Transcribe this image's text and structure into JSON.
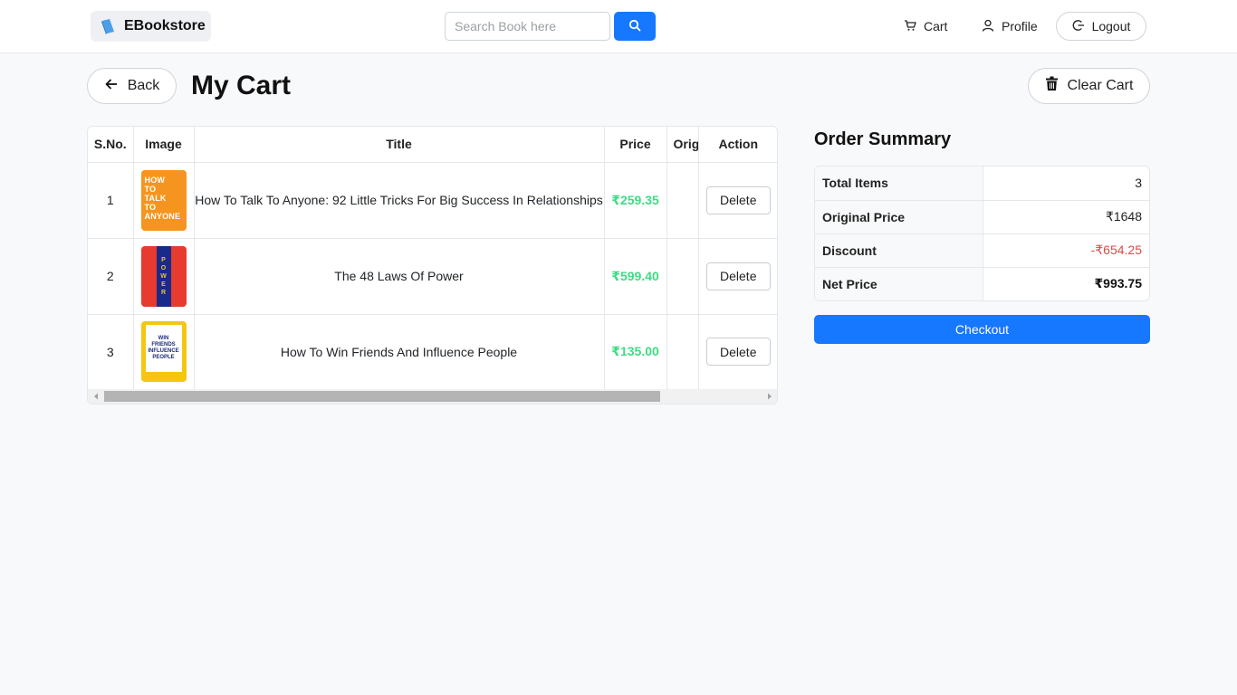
{
  "navbar": {
    "brand": "EBookstore",
    "brand_icon": "book-icon",
    "search_placeholder": "Search Book here",
    "search_icon": "search-icon",
    "cart_label": "Cart",
    "profile_label": "Profile",
    "logout_label": "Logout"
  },
  "header": {
    "back_label": "Back",
    "title": "My Cart",
    "clear_label": "Clear Cart"
  },
  "cart_table": {
    "columns": [
      "S.No.",
      "Image",
      "Title",
      "Price",
      "Orig",
      "Action"
    ],
    "rows": [
      {
        "sno": "1",
        "title": "How To Talk To Anyone: 92 Little Tricks For Big Success In Relationships",
        "price": "₹259.35",
        "action": "Delete",
        "cover_text": [
          "HOW",
          "TO",
          "TALK",
          "TO",
          "ANYONE"
        ]
      },
      {
        "sno": "2",
        "title": "The 48 Laws Of Power",
        "price": "₹599.40",
        "action": "Delete",
        "cover_text": [
          "P",
          "O",
          "W",
          "E",
          "R"
        ]
      },
      {
        "sno": "3",
        "title": "How To Win Friends And Influence People",
        "price": "₹135.00",
        "action": "Delete",
        "cover_text": [
          "WIN",
          "FRIENDS",
          "INFLUENCE",
          "PEOPLE"
        ]
      }
    ]
  },
  "summary": {
    "title": "Order Summary",
    "rows": [
      {
        "label": "Total Items",
        "value": "3"
      },
      {
        "label": "Original Price",
        "value": "₹1648"
      },
      {
        "label": "Discount",
        "value": "-₹654.25"
      },
      {
        "label": "Net Price",
        "value": "₹993.75"
      }
    ],
    "checkout_label": "Checkout"
  },
  "colors": {
    "primary": "#1677ff",
    "price_green": "#3ddc84",
    "discount_red": "#e04848"
  }
}
